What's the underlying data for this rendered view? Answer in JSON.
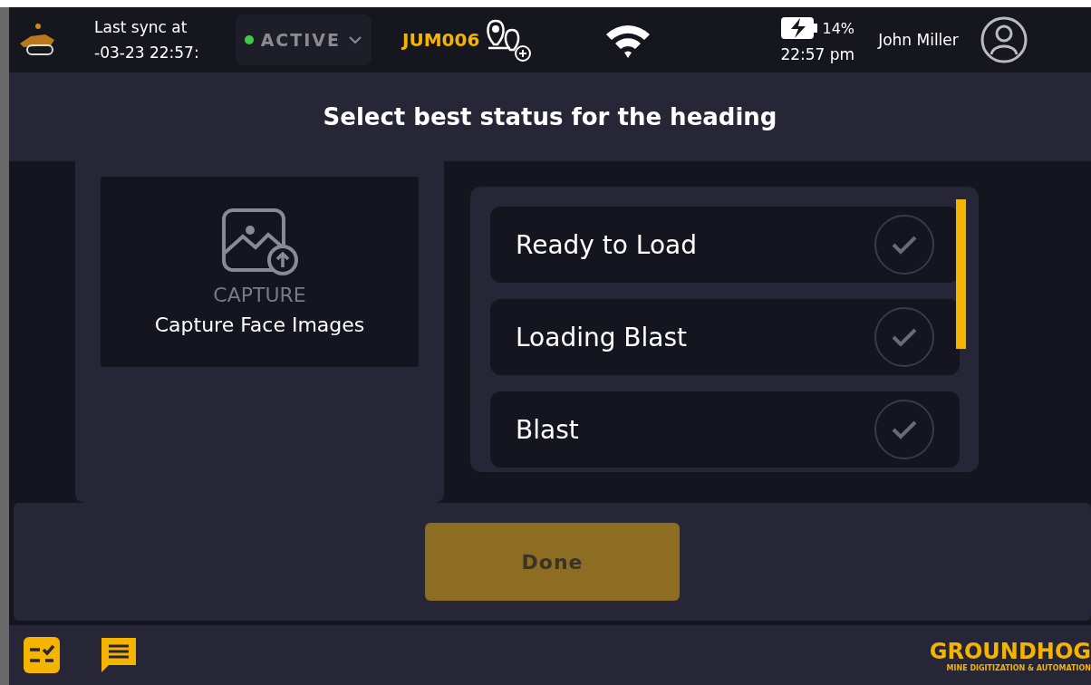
{
  "header": {
    "sync_label": "Last sync at",
    "sync_time": "-03-23 22:57:",
    "status": "ACTIVE",
    "unit": "JUM006",
    "battery": "14%",
    "time": "22:57 pm",
    "user": "John Miller"
  },
  "title": "Select best status for the heading",
  "capture": {
    "label": "CAPTURE",
    "title": "Capture Face Images"
  },
  "statuses": [
    {
      "label": "Ready to Load",
      "selected": false
    },
    {
      "label": "Loading Blast",
      "selected": false
    },
    {
      "label": "Blast",
      "selected": false
    }
  ],
  "done": {
    "label": "Done",
    "disabled": true
  },
  "brand": {
    "name": "GROUNDHOG",
    "tagline": "MINE DIGITIZATION & AUTOMATION"
  }
}
